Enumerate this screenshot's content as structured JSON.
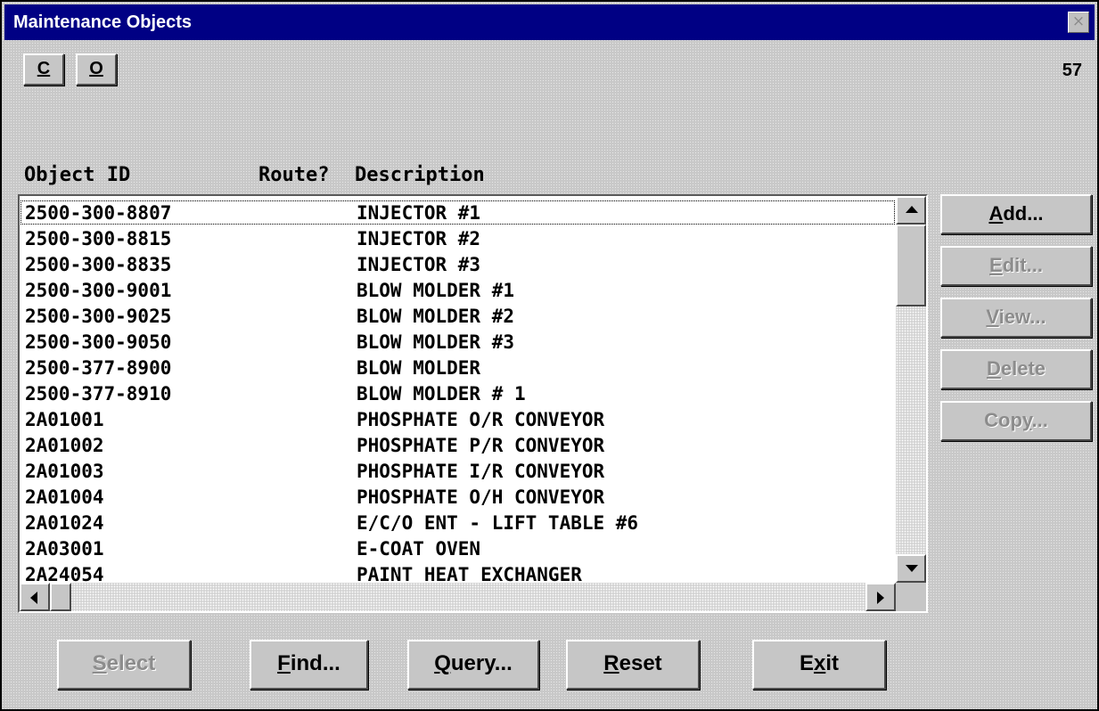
{
  "window": {
    "title": "Maintenance Objects",
    "close_glyph": "×"
  },
  "toolbar": {
    "buttons": [
      {
        "label": "C",
        "icon": "none"
      },
      {
        "label": "O",
        "icon": "none"
      }
    ],
    "record_count": "57"
  },
  "list": {
    "headers": {
      "object_id": "Object ID",
      "route": "Route?",
      "description": "Description"
    },
    "rows": [
      {
        "object_id": "2500-300-8807",
        "route": "",
        "description": "INJECTOR #1"
      },
      {
        "object_id": "2500-300-8815",
        "route": "",
        "description": "INJECTOR #2"
      },
      {
        "object_id": "2500-300-8835",
        "route": "",
        "description": "INJECTOR #3"
      },
      {
        "object_id": "2500-300-9001",
        "route": "",
        "description": "BLOW MOLDER #1"
      },
      {
        "object_id": "2500-300-9025",
        "route": "",
        "description": "BLOW MOLDER #2"
      },
      {
        "object_id": "2500-300-9050",
        "route": "",
        "description": "BLOW MOLDER #3"
      },
      {
        "object_id": "2500-377-8900",
        "route": "",
        "description": "BLOW MOLDER"
      },
      {
        "object_id": "2500-377-8910",
        "route": "",
        "description": "BLOW MOLDER # 1"
      },
      {
        "object_id": "2A01001",
        "route": "",
        "description": "PHOSPHATE O/R CONVEYOR"
      },
      {
        "object_id": "2A01002",
        "route": "",
        "description": "PHOSPHATE P/R CONVEYOR"
      },
      {
        "object_id": "2A01003",
        "route": "",
        "description": "PHOSPHATE I/R CONVEYOR"
      },
      {
        "object_id": "2A01004",
        "route": "",
        "description": "PHOSPHATE O/H CONVEYOR"
      },
      {
        "object_id": "2A01024",
        "route": "",
        "description": "E/C/O ENT - LIFT TABLE #6"
      },
      {
        "object_id": "2A03001",
        "route": "",
        "description": "E-COAT OVEN"
      },
      {
        "object_id": "2A24054",
        "route": "",
        "description": "PAINT HEAT EXCHANGER"
      }
    ],
    "focused_row": 0,
    "vertical_scroll_position": 0,
    "horizontal_scroll_position": 0
  },
  "side_buttons": [
    {
      "pre": "",
      "key": "A",
      "post": "dd...",
      "enabled": true
    },
    {
      "pre": "",
      "key": "E",
      "post": "dit...",
      "enabled": false
    },
    {
      "pre": "",
      "key": "V",
      "post": "iew...",
      "enabled": false
    },
    {
      "pre": "",
      "key": "D",
      "post": "elete",
      "enabled": false
    },
    {
      "pre": "Cop",
      "key": "y",
      "post": "...",
      "enabled": false
    }
  ],
  "bottom_buttons": [
    {
      "pre": "",
      "key": "S",
      "post": "elect",
      "enabled": false
    },
    {
      "pre": "",
      "key": "F",
      "post": "ind...",
      "enabled": true
    },
    {
      "pre": "",
      "key": "Q",
      "post": "uery...",
      "enabled": true
    },
    {
      "pre": "",
      "key": "R",
      "post": "eset",
      "enabled": true
    },
    {
      "pre": "E",
      "key": "x",
      "post": "it",
      "enabled": true
    }
  ],
  "icons": {
    "close": "close-icon",
    "scroll_up": "arrow-up-icon",
    "scroll_down": "arrow-down-icon",
    "scroll_left": "arrow-left-icon",
    "scroll_right": "arrow-right-icon"
  },
  "colors": {
    "titlebar": "#000084",
    "window_bg": "#c8c8c8",
    "disabled_text": "#8c8c8c"
  }
}
